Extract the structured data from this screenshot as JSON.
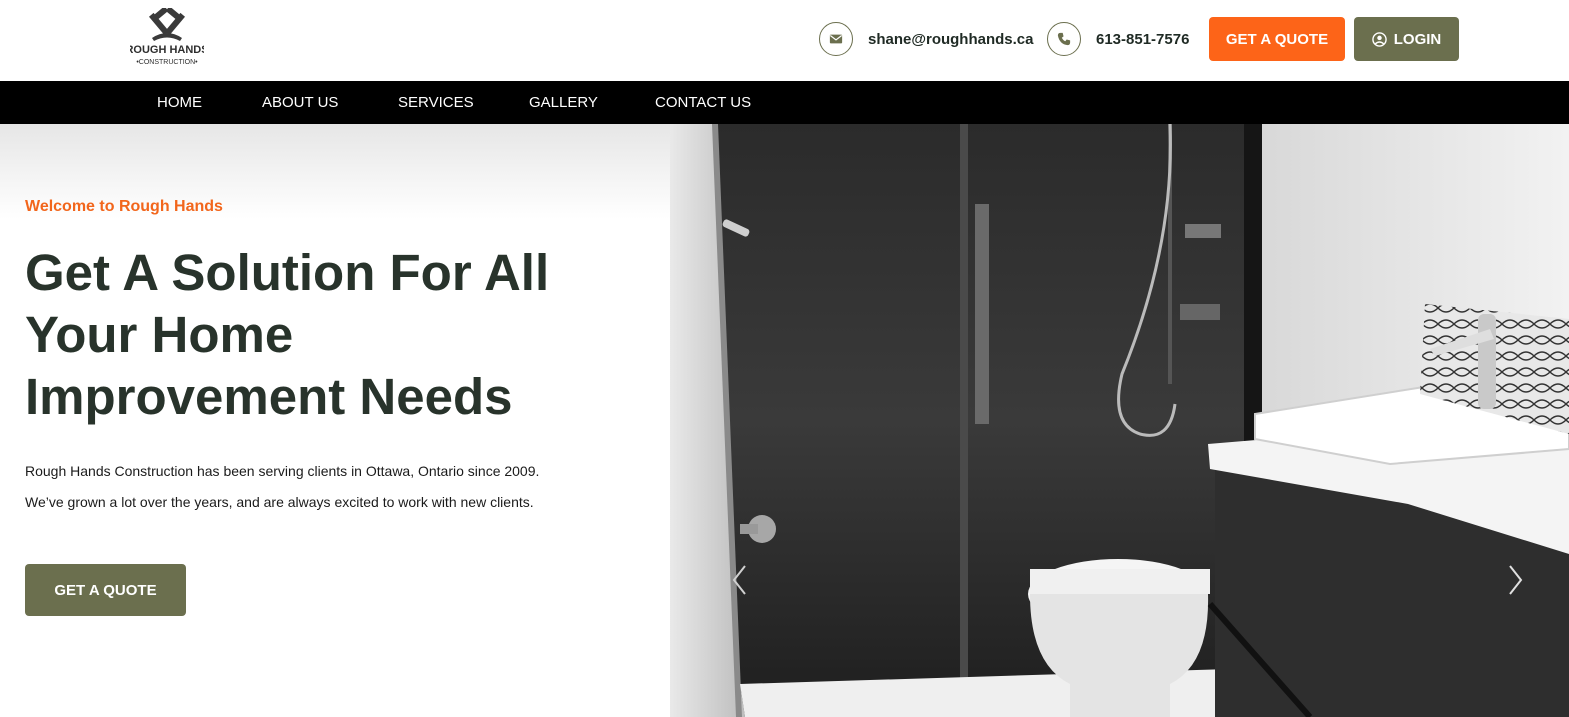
{
  "brand": {
    "logo_line1": "ROUGH HANDS",
    "logo_line2": "•CONSTRUCTION•",
    "colors": {
      "accent_orange": "#fd6418",
      "olive": "#6b6f4e",
      "heading": "#28332b",
      "nav_bg": "#000000"
    }
  },
  "header": {
    "email_icon": "envelope-icon",
    "email": "shane@roughhands.ca",
    "phone_icon": "phone-icon",
    "phone": "613-851-7576",
    "quote_button": "GET A QUOTE",
    "login_icon": "user-circle-icon",
    "login_button": "LOGIN"
  },
  "nav": {
    "items": [
      {
        "label": "HOME"
      },
      {
        "label": "ABOUT US"
      },
      {
        "label": "SERVICES"
      },
      {
        "label": "GALLERY"
      },
      {
        "label": "CONTACT US"
      }
    ]
  },
  "hero": {
    "eyebrow": "Welcome to Rough Hands",
    "title_line1": "Get A Solution For All",
    "title_line2": "Your Home",
    "title_line3": "Improvement Needs",
    "body_line1": "Rough Hands Construction has been serving clients in Ottawa, Ontario since 2009.",
    "body_line2": "We’ve grown a lot over the years, and are always excited to work with new clients.",
    "cta": "GET A QUOTE"
  },
  "slider": {
    "prev_icon": "chevron-left-icon",
    "next_icon": "chevron-right-icon"
  }
}
